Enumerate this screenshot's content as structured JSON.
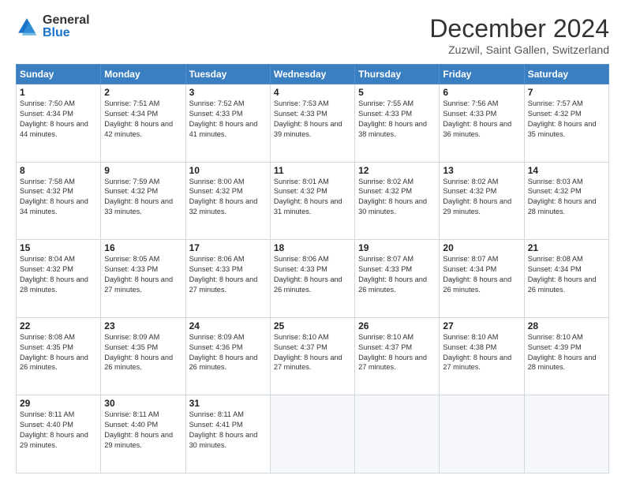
{
  "header": {
    "logo_general": "General",
    "logo_blue": "Blue",
    "month_title": "December 2024",
    "location": "Zuzwil, Saint Gallen, Switzerland"
  },
  "days_of_week": [
    "Sunday",
    "Monday",
    "Tuesday",
    "Wednesday",
    "Thursday",
    "Friday",
    "Saturday"
  ],
  "weeks": [
    [
      {
        "day": 1,
        "sunrise": "7:50 AM",
        "sunset": "4:34 PM",
        "daylight": "8 hours and 44 minutes."
      },
      {
        "day": 2,
        "sunrise": "7:51 AM",
        "sunset": "4:34 PM",
        "daylight": "8 hours and 42 minutes."
      },
      {
        "day": 3,
        "sunrise": "7:52 AM",
        "sunset": "4:33 PM",
        "daylight": "8 hours and 41 minutes."
      },
      {
        "day": 4,
        "sunrise": "7:53 AM",
        "sunset": "4:33 PM",
        "daylight": "8 hours and 39 minutes."
      },
      {
        "day": 5,
        "sunrise": "7:55 AM",
        "sunset": "4:33 PM",
        "daylight": "8 hours and 38 minutes."
      },
      {
        "day": 6,
        "sunrise": "7:56 AM",
        "sunset": "4:33 PM",
        "daylight": "8 hours and 36 minutes."
      },
      {
        "day": 7,
        "sunrise": "7:57 AM",
        "sunset": "4:32 PM",
        "daylight": "8 hours and 35 minutes."
      }
    ],
    [
      {
        "day": 8,
        "sunrise": "7:58 AM",
        "sunset": "4:32 PM",
        "daylight": "8 hours and 34 minutes."
      },
      {
        "day": 9,
        "sunrise": "7:59 AM",
        "sunset": "4:32 PM",
        "daylight": "8 hours and 33 minutes."
      },
      {
        "day": 10,
        "sunrise": "8:00 AM",
        "sunset": "4:32 PM",
        "daylight": "8 hours and 32 minutes."
      },
      {
        "day": 11,
        "sunrise": "8:01 AM",
        "sunset": "4:32 PM",
        "daylight": "8 hours and 31 minutes."
      },
      {
        "day": 12,
        "sunrise": "8:02 AM",
        "sunset": "4:32 PM",
        "daylight": "8 hours and 30 minutes."
      },
      {
        "day": 13,
        "sunrise": "8:02 AM",
        "sunset": "4:32 PM",
        "daylight": "8 hours and 29 minutes."
      },
      {
        "day": 14,
        "sunrise": "8:03 AM",
        "sunset": "4:32 PM",
        "daylight": "8 hours and 28 minutes."
      }
    ],
    [
      {
        "day": 15,
        "sunrise": "8:04 AM",
        "sunset": "4:32 PM",
        "daylight": "8 hours and 28 minutes."
      },
      {
        "day": 16,
        "sunrise": "8:05 AM",
        "sunset": "4:33 PM",
        "daylight": "8 hours and 27 minutes."
      },
      {
        "day": 17,
        "sunrise": "8:06 AM",
        "sunset": "4:33 PM",
        "daylight": "8 hours and 27 minutes."
      },
      {
        "day": 18,
        "sunrise": "8:06 AM",
        "sunset": "4:33 PM",
        "daylight": "8 hours and 26 minutes."
      },
      {
        "day": 19,
        "sunrise": "8:07 AM",
        "sunset": "4:33 PM",
        "daylight": "8 hours and 26 minutes."
      },
      {
        "day": 20,
        "sunrise": "8:07 AM",
        "sunset": "4:34 PM",
        "daylight": "8 hours and 26 minutes."
      },
      {
        "day": 21,
        "sunrise": "8:08 AM",
        "sunset": "4:34 PM",
        "daylight": "8 hours and 26 minutes."
      }
    ],
    [
      {
        "day": 22,
        "sunrise": "8:08 AM",
        "sunset": "4:35 PM",
        "daylight": "8 hours and 26 minutes."
      },
      {
        "day": 23,
        "sunrise": "8:09 AM",
        "sunset": "4:35 PM",
        "daylight": "8 hours and 26 minutes."
      },
      {
        "day": 24,
        "sunrise": "8:09 AM",
        "sunset": "4:36 PM",
        "daylight": "8 hours and 26 minutes."
      },
      {
        "day": 25,
        "sunrise": "8:10 AM",
        "sunset": "4:37 PM",
        "daylight": "8 hours and 27 minutes."
      },
      {
        "day": 26,
        "sunrise": "8:10 AM",
        "sunset": "4:37 PM",
        "daylight": "8 hours and 27 minutes."
      },
      {
        "day": 27,
        "sunrise": "8:10 AM",
        "sunset": "4:38 PM",
        "daylight": "8 hours and 27 minutes."
      },
      {
        "day": 28,
        "sunrise": "8:10 AM",
        "sunset": "4:39 PM",
        "daylight": "8 hours and 28 minutes."
      }
    ],
    [
      {
        "day": 29,
        "sunrise": "8:11 AM",
        "sunset": "4:40 PM",
        "daylight": "8 hours and 29 minutes."
      },
      {
        "day": 30,
        "sunrise": "8:11 AM",
        "sunset": "4:40 PM",
        "daylight": "8 hours and 29 minutes."
      },
      {
        "day": 31,
        "sunrise": "8:11 AM",
        "sunset": "4:41 PM",
        "daylight": "8 hours and 30 minutes."
      },
      null,
      null,
      null,
      null
    ]
  ]
}
